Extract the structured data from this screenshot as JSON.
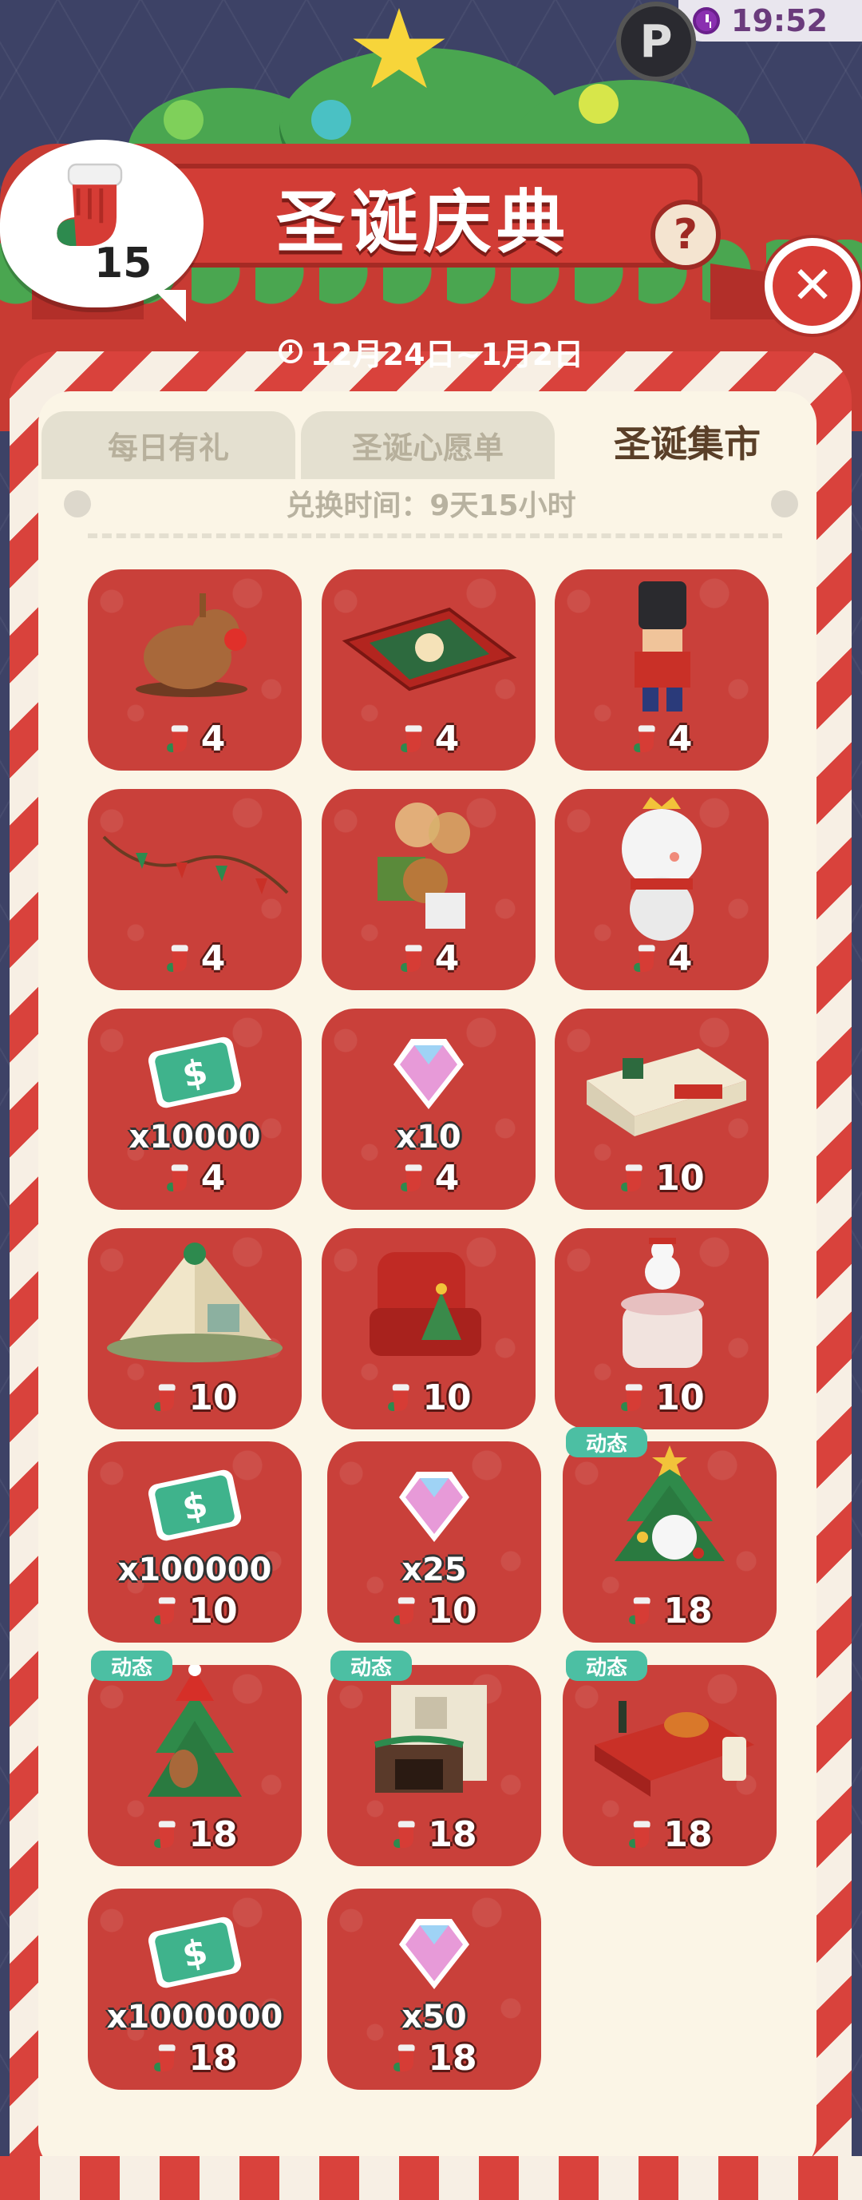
{
  "status_bar": {
    "time": "19:52"
  },
  "event": {
    "title": "圣诞庆典",
    "help_label": "?",
    "close_label": "✕",
    "currency_count": "15",
    "date_range": "12月24日~1月2日"
  },
  "tabs": [
    {
      "label": "每日有礼",
      "active": false
    },
    {
      "label": "圣诞心愿单",
      "active": false
    },
    {
      "label": "圣诞集市",
      "active": true
    }
  ],
  "shop": {
    "exchange_time": "兑换时间：9天15小时",
    "items": [
      {
        "icon": "reindeer-rocker-icon",
        "price": "4",
        "qty": "",
        "badge": ""
      },
      {
        "icon": "christmas-rug-icon",
        "price": "4",
        "qty": "",
        "badge": ""
      },
      {
        "icon": "nutcracker-soldier-icon",
        "price": "4",
        "qty": "",
        "badge": ""
      },
      {
        "icon": "garland-icon",
        "price": "4",
        "qty": "",
        "badge": ""
      },
      {
        "icon": "bear-gift-balloons-icon",
        "price": "4",
        "qty": "",
        "badge": ""
      },
      {
        "icon": "snowman-crown-icon",
        "price": "4",
        "qty": "",
        "badge": ""
      },
      {
        "icon": "cash-icon",
        "price": "4",
        "qty": "x10000",
        "badge": ""
      },
      {
        "icon": "diamond-icon",
        "price": "4",
        "qty": "x10",
        "badge": ""
      },
      {
        "icon": "christmas-sofa-icon",
        "price": "10",
        "qty": "",
        "badge": ""
      },
      {
        "icon": "tent-cabin-icon",
        "price": "10",
        "qty": "",
        "badge": ""
      },
      {
        "icon": "red-armchair-icon",
        "price": "10",
        "qty": "",
        "badge": ""
      },
      {
        "icon": "snowman-table-icon",
        "price": "10",
        "qty": "",
        "badge": ""
      },
      {
        "icon": "cash-icon",
        "price": "10",
        "qty": "x100000",
        "badge": ""
      },
      {
        "icon": "diamond-icon",
        "price": "10",
        "qty": "x25",
        "badge": ""
      },
      {
        "icon": "snowman-tree-icon",
        "price": "18",
        "qty": "",
        "badge": "动态"
      },
      {
        "icon": "tree-guitar-icon",
        "price": "18",
        "qty": "",
        "badge": "动态"
      },
      {
        "icon": "fireplace-icon",
        "price": "18",
        "qty": "",
        "badge": "动态"
      },
      {
        "icon": "dinner-table-icon",
        "price": "18",
        "qty": "",
        "badge": "动态"
      },
      {
        "icon": "cash-icon",
        "price": "18",
        "qty": "x1000000",
        "badge": ""
      },
      {
        "icon": "diamond-icon",
        "price": "18",
        "qty": "x50",
        "badge": ""
      }
    ]
  },
  "colors": {
    "card_red": "#c9403a",
    "badge_teal": "#4cbfa3",
    "cash_green": "#3fb38c",
    "diamond_pink": "#e79ad8",
    "sock_red": "#d63c35",
    "sock_green": "#2d8a4e"
  }
}
